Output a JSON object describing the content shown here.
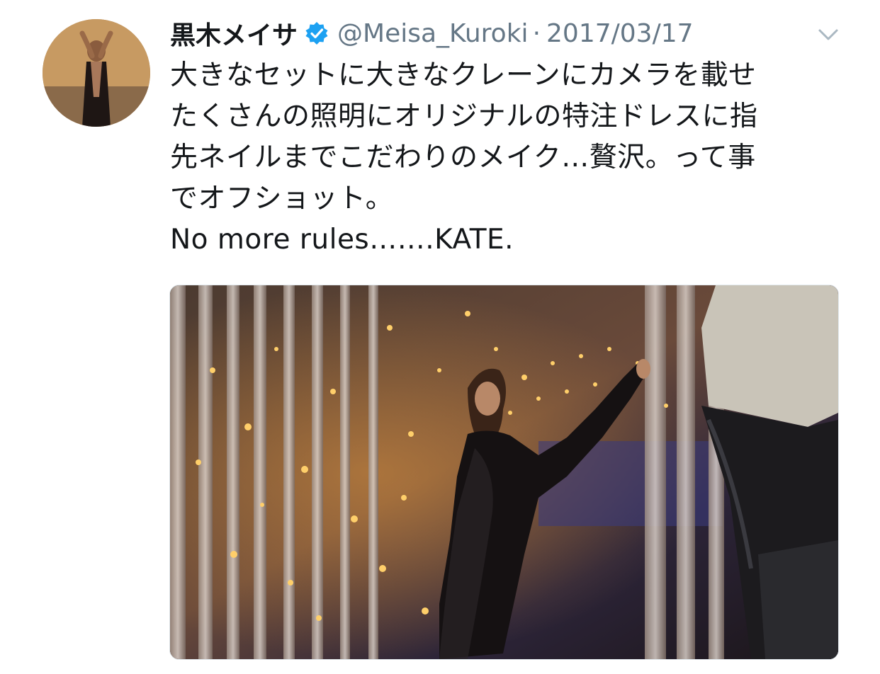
{
  "tweet": {
    "display_name": "黒木メイサ",
    "handle": "@Meisa_Kuroki",
    "separator": "·",
    "date": "2017/03/17",
    "text_lines": [
      "大きなセットに大きなクレーンにカメラを載せ",
      "たくさんの照明にオリジナルの特注ドレスに指",
      "先ネイルまでこだわりのメイク…贅沢。って事",
      "でオフショット。",
      "No more rules…….KATE."
    ]
  },
  "icons": {
    "verified": "verified-badge-icon",
    "menu": "chevron-down-icon"
  },
  "colors": {
    "verified_blue": "#1da1f2",
    "secondary_text": "#657786",
    "primary_text": "#14171a"
  }
}
